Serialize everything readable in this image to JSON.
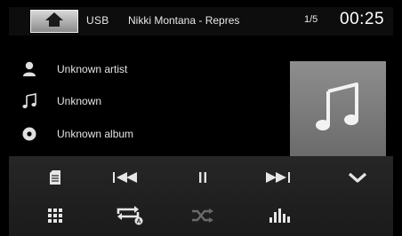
{
  "topbar": {
    "source": "USB",
    "title": "Nikki Montana - Repres",
    "track_count": "1/5",
    "clock": "00:25"
  },
  "info": {
    "artist": "Unknown artist",
    "title": "Unknown",
    "album": "Unknown album"
  },
  "icons": {
    "home": "home-icon",
    "artist": "person-icon",
    "title": "music-note-icon",
    "album": "disc-icon",
    "album_art": "music-note-icon",
    "playlist": "playlist-icon",
    "previous": "skip-previous-icon",
    "pause": "pause-icon",
    "next": "skip-next-icon",
    "collapse": "chevron-down-icon",
    "grid": "grid-menu-icon",
    "repeat": "repeat-all-icon",
    "shuffle": "shuffle-icon",
    "equalizer": "equalizer-icon"
  },
  "colors": {
    "background": "#000000",
    "control_bar": "#222222",
    "icon_active": "#e6e6e6",
    "icon_dim": "#6a6a6a",
    "album_art": "#7d7d7d"
  }
}
